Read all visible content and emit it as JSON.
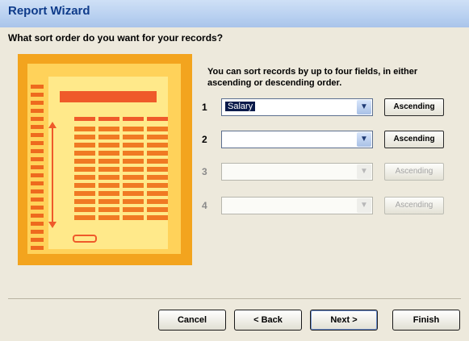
{
  "window": {
    "title": "Report Wizard"
  },
  "question": "What sort order do you want for your records?",
  "instructions": "You can sort records by up to four fields, in either ascending or descending order.",
  "sort_fields": [
    {
      "number": "1",
      "value": "Salary",
      "direction": "Ascending",
      "enabled": true
    },
    {
      "number": "2",
      "value": "",
      "direction": "Ascending",
      "enabled": true
    },
    {
      "number": "3",
      "value": "",
      "direction": "Ascending",
      "enabled": false
    },
    {
      "number": "4",
      "value": "",
      "direction": "Ascending",
      "enabled": false
    }
  ],
  "buttons": {
    "cancel": "Cancel",
    "back": "< Back",
    "next": "Next >",
    "finish": "Finish"
  },
  "colors": {
    "title_bar": "#b8d0f0",
    "illustration_orange": "#f3a41e",
    "illustration_red": "#ef5a2a"
  },
  "icons": [
    "chevron-down-icon",
    "report-layout-illustration"
  ]
}
